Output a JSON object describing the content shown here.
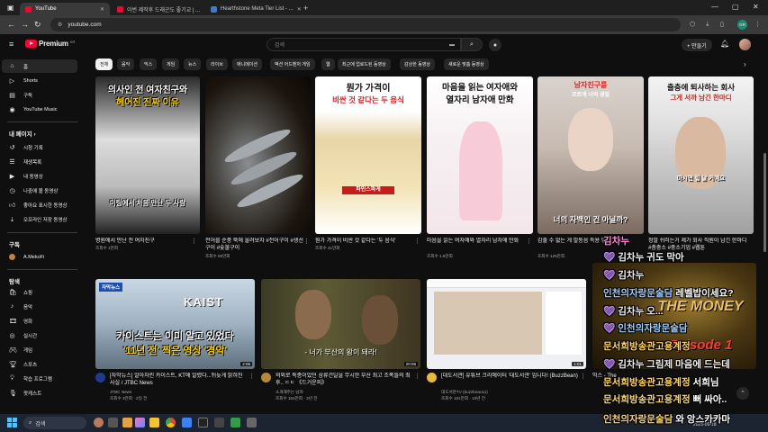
{
  "browser": {
    "tabs": [
      {
        "title": "YouTube",
        "color": "#ff0033"
      },
      {
        "title": "이번 제작후 드래곤도 좋기교 | ...",
        "color": "#ff0033"
      },
      {
        "title": "Hearthstone Meta Tier List - ...",
        "color": "#3a7bd5"
      }
    ],
    "url": "youtube.com",
    "profile_badge": "GR"
  },
  "header": {
    "logo_text": "Premium",
    "logo_sup": "KR",
    "search_placeholder": "검색",
    "create_label": "+ 만들기"
  },
  "sidebar": {
    "main": [
      {
        "label": "홈",
        "icon": "home-icon"
      },
      {
        "label": "Shorts",
        "icon": "shorts-icon"
      },
      {
        "label": "구독",
        "icon": "subscriptions-icon"
      },
      {
        "label": "YouTube Music",
        "icon": "music-icon"
      }
    ],
    "you_heading": "내 페이지 ›",
    "you": [
      {
        "label": "시청 기록",
        "icon": "history-icon"
      },
      {
        "label": "재생목록",
        "icon": "playlist-icon"
      },
      {
        "label": "내 동영상",
        "icon": "video-icon"
      },
      {
        "label": "나중에 볼 동영상",
        "icon": "clock-icon"
      },
      {
        "label": "좋아요 표시한 동영상",
        "icon": "like-icon"
      },
      {
        "label": "오프라인 저장 동영상",
        "icon": "download-icon"
      }
    ],
    "subs_heading": "구독",
    "subs": [
      {
        "label": "A.MekoFi",
        "icon": "channel-avatar"
      }
    ],
    "explore_heading": "탐색",
    "explore": [
      {
        "label": "쇼핑",
        "icon": "shopping-icon"
      },
      {
        "label": "음악",
        "icon": "music-note-icon"
      },
      {
        "label": "영화",
        "icon": "movie-icon"
      },
      {
        "label": "실시간",
        "icon": "live-icon"
      },
      {
        "label": "게임",
        "icon": "gaming-icon"
      },
      {
        "label": "스포츠",
        "icon": "trophy-icon"
      },
      {
        "label": "학습 프로그램",
        "icon": "learning-icon"
      },
      {
        "label": "팟캐스트",
        "icon": "podcast-icon"
      }
    ]
  },
  "chips": [
    "전체",
    "음악",
    "믹스",
    "게임",
    "뉴스",
    "라이브",
    "애니메이션",
    "액션 어드벤처 게임",
    "웹",
    "최근에 업로드된 동영상",
    "감상한 동영상",
    "새로운 맞춤 동영상"
  ],
  "videos_row1": [
    {
      "cap_top": "의사인 전 여자친구와",
      "cap_mid": "헤어진 진짜 이유",
      "cap_bot": "미팅에서 처음 만난 두 사람",
      "title": "병원에서 만난 전 여자친구",
      "meta": "조회수 1만회",
      "dur": ""
    },
    {
      "cap_top": "",
      "cap_mid": "",
      "cap_bot": "",
      "title": "전어를 순풍 뚝에 올려보자 #전어구이 #생선구이 #숯불구이",
      "meta": "조회수 69만회",
      "dur": ""
    },
    {
      "cap_top": "뭔가 가격이",
      "cap_mid": "비싼 것 같다는 두 음식",
      "cap_bot": "파인스파게",
      "title": "뭔가 가격이 비싼 것 같다는 '두 음식'",
      "meta": "조회수 41만회",
      "dur": ""
    },
    {
      "cap_top": "마음을 읽는 여자애와",
      "cap_mid": "열자리 남자애 만화",
      "cap_bot": "",
      "title": "마음을 읽는 여자애와 열자리 남자애 만화",
      "meta": "조회수 1.6만회",
      "dur": ""
    },
    {
      "cap_top": "남자친구를",
      "cap_mid": "모르게 너의 생일",
      "cap_bot": "너의 자백인 건 아닐까?",
      "title": "감출 수 없는 게 발동음 특용 망토 크 치",
      "meta": "조회수 125만회",
      "dur": ""
    },
    {
      "cap_top": "출충에 퇴사하는 회사",
      "cap_mid": "그게 서까 남긴 한마디",
      "cap_bot": "마시면 힘 날 거예요",
      "title": "정말 쉬러는거 제가 회사 직원이 남긴 한마디 #충충소 #중소기업 #웹툰",
      "meta": "조회수 ...",
      "dur": ""
    }
  ],
  "videos_row2": [
    {
      "badge": "자막뉴스",
      "cap": "'11년 전' 찍은 영상 '경악'",
      "cap_sub": "카이스트는 이미 알고 있었다",
      "title": "[자막뉴스] 알아차린 카이스트, KT에 알렸다...뒤늦게 밝혀진 사실 / JTBC News",
      "channel": "JTBC News",
      "meta": "조회수 3만회 · 2일 전",
      "dur": "2:06"
    },
    {
      "badge": "",
      "cap": "- 너가 부산의 왕이 돼라!",
      "cap_sub": "",
      "title": "의외로 독종이었던 삼류건달을 무시한 부산 최고 조폭들의 최후.. ㄷㄷ 《드거운피》",
      "channel": "소개해주는 남자",
      "meta": "조회수 154만회 · 3년 전",
      "dur": "20:06"
    },
    {
      "badge": "",
      "cap": "",
      "cap_sub": "",
      "title": "[대도서관] 유튜브 크리에이터 '대도서관' 입니다! (BuzzBean)",
      "channel": "대도서관TV (buzzbean11)",
      "meta": "조회수 181만회 · 10년 전",
      "dur": "1:01"
    },
    {
      "badge": "",
      "cap": "THE MONEY",
      "cap_sub": "Episode 1",
      "title": "믹스 - The Money 7",
      "channel": "",
      "meta": "",
      "dur": ""
    }
  ],
  "overlay_chat": [
    {
      "name": "김차누",
      "msg": "귀도 막아",
      "heart": true
    },
    {
      "name": "김차누",
      "msg": "레벨밥이세요?",
      "heart": true
    },
    {
      "name": "인천의자랑문술담",
      "msg": "",
      "heart": false
    },
    {
      "name": "김차누",
      "msg": "오...",
      "heart": true
    },
    {
      "name": "인천의자랑문술담",
      "msg": "",
      "heart": true
    },
    {
      "name": "문서희방송관고용계정",
      "msg": "",
      "heart": false
    },
    {
      "name": "김차누",
      "msg": "그림제 마음에 드는데",
      "heart": true
    },
    {
      "name": "문서희방송관고용계정",
      "msg": "서희님",
      "heart": false
    },
    {
      "name": "문서희방송관고용계정",
      "msg": "뻐 싸아..",
      "heart": false
    },
    {
      "name": "인천의자랑문술담",
      "msg": "와 앙스카카마",
      "heart": false
    }
  ],
  "taskbar": {
    "search": "검색",
    "time": "오후 10:12",
    "date": "2025-09-18"
  }
}
